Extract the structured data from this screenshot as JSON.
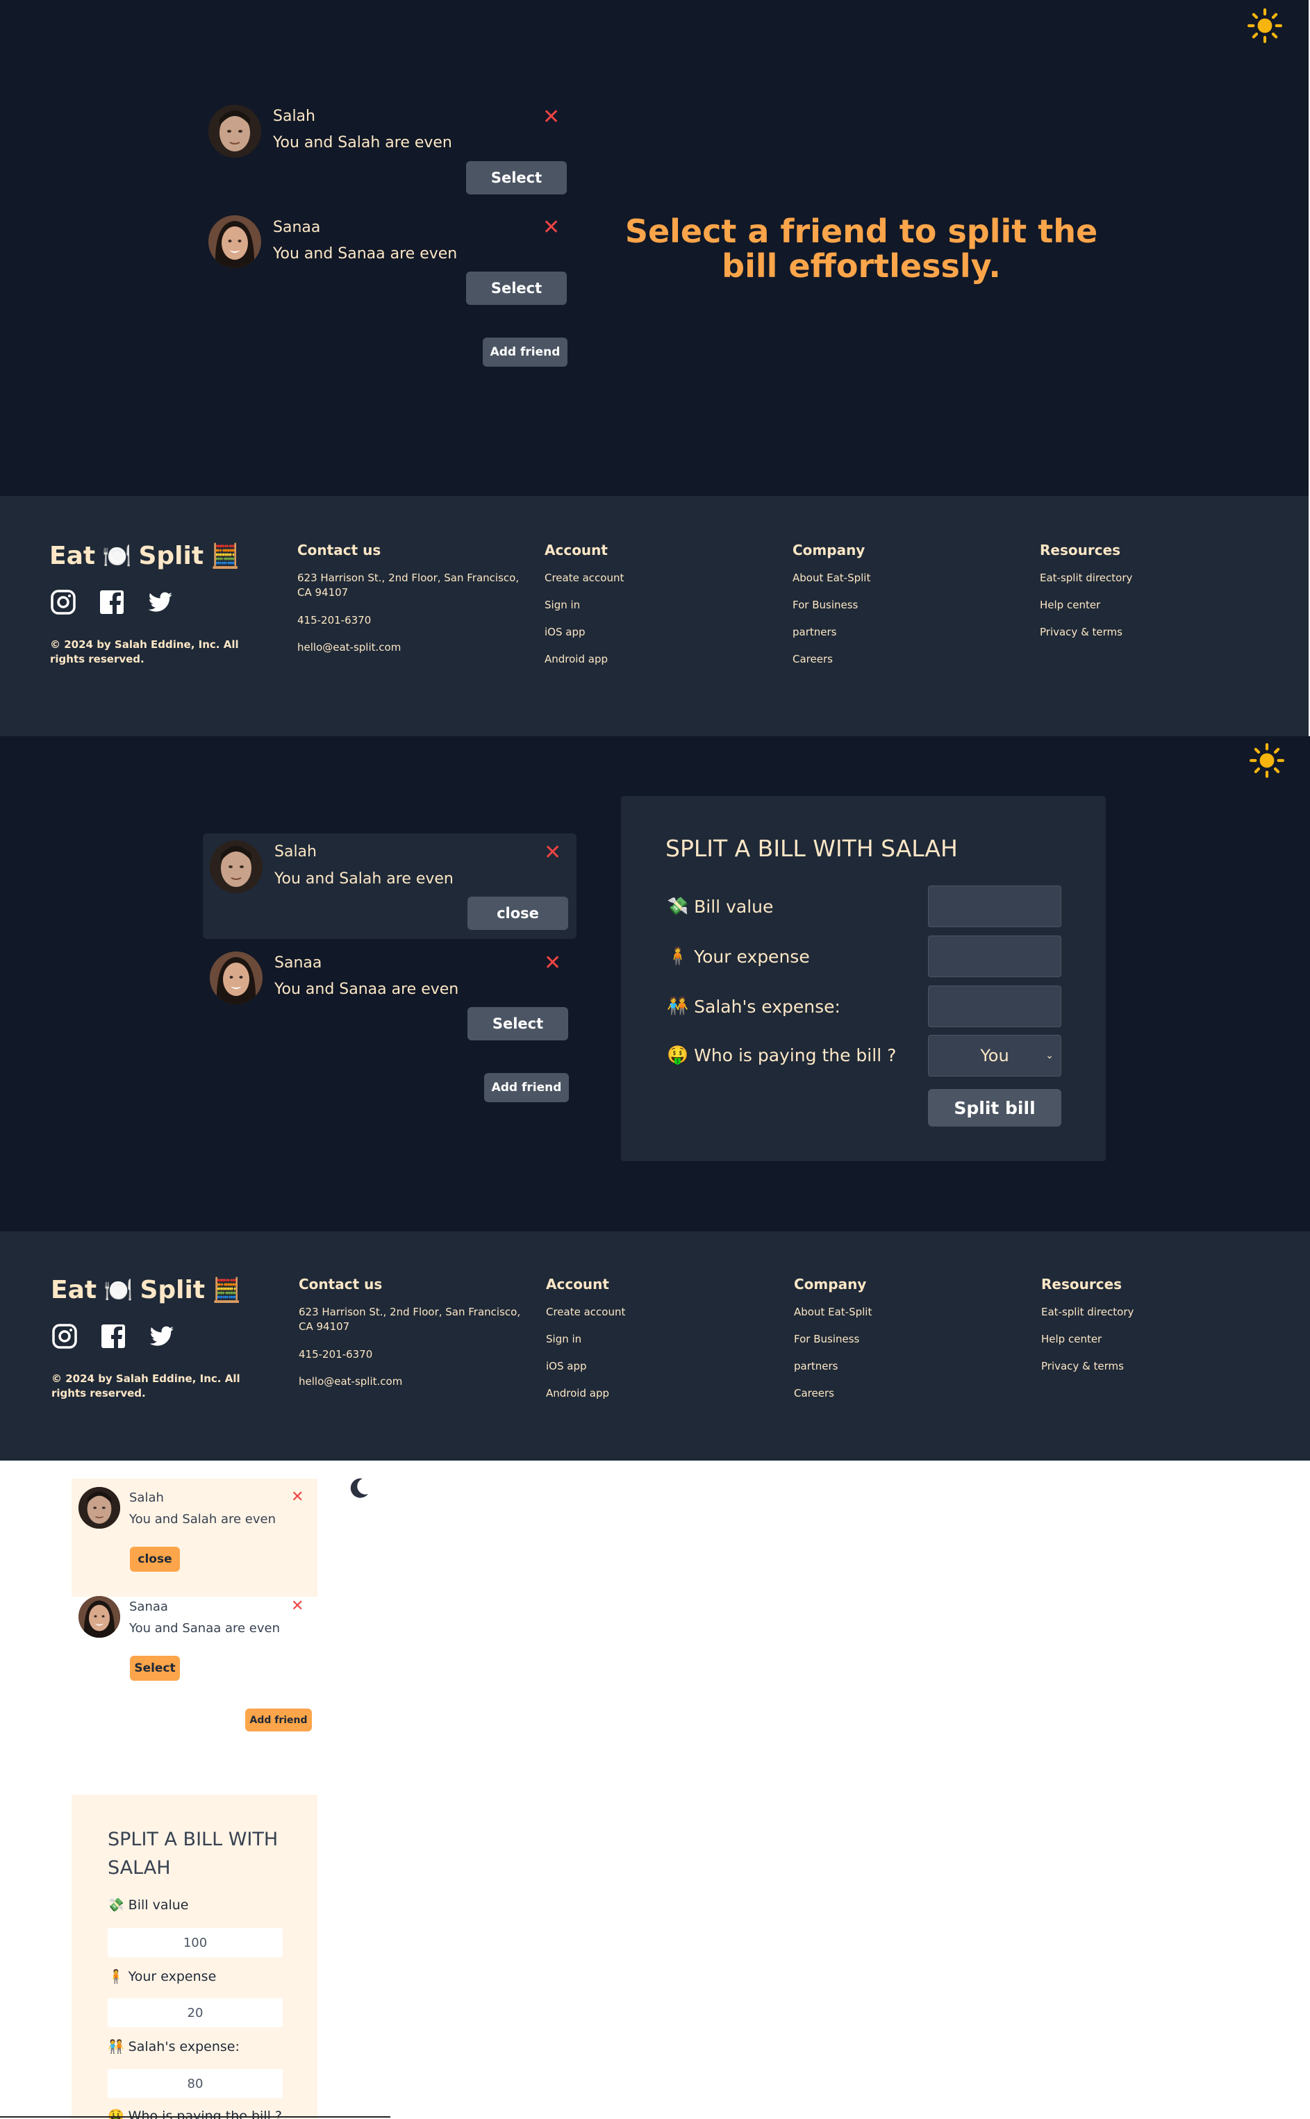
{
  "screen1": {
    "friends": [
      {
        "name": "Salah",
        "status": "You and Salah are even",
        "action": "Select"
      },
      {
        "name": "Sanaa",
        "status": "You and Sanaa are even",
        "action": "Select"
      }
    ],
    "add_friend": "Add friend",
    "headline": "Select a friend to split the bill effortlessly.",
    "theme_icon": "sun-icon"
  },
  "screen2": {
    "friends": [
      {
        "name": "Salah",
        "status": "You and Salah are even",
        "action": "close"
      },
      {
        "name": "Sanaa",
        "status": "You and Sanaa are even",
        "action": "Select"
      }
    ],
    "add_friend": "Add friend",
    "form": {
      "title": "SPLIT A BILL WITH SALAH",
      "bill_label": "Bill value",
      "your_label": "Your expense",
      "friend_label": "Salah's expense:",
      "payer_label": "Who is paying the bill ?",
      "payer_value": "You",
      "submit": "Split bill"
    }
  },
  "screen3": {
    "friends": [
      {
        "name": "Salah",
        "status": "You and Salah are even",
        "action": "close"
      },
      {
        "name": "Sanaa",
        "status": "You and Sanaa are even",
        "action": "Select"
      }
    ],
    "add_friend": "Add friend",
    "form": {
      "title": "SPLIT A BILL WITH SALAH",
      "bill_label": "Bill value",
      "bill_value": "100",
      "your_label": "Your expense",
      "your_value": "20",
      "friend_label": "Salah's expense:",
      "friend_value": "80",
      "payer_label": "Who is paying the bill ?"
    },
    "theme_icon": "moon-icon"
  },
  "footer": {
    "logo_left": "Eat",
    "logo_right": "Split",
    "copyright": "© 2024 by Salah Eddine, Inc. All rights reserved.",
    "contact": {
      "heading": "Contact us",
      "address": "623 Harrison St., 2nd Floor, San Francisco, CA 94107",
      "phone": "415-201-6370",
      "email": "hello@eat-split.com"
    },
    "account": {
      "heading": "Account",
      "items": [
        "Create account",
        "Sign in",
        "iOS app",
        "Android app"
      ]
    },
    "company": {
      "heading": "Company",
      "items": [
        "About Eat-Split",
        "For Business",
        "partners",
        "Careers"
      ]
    },
    "resources": {
      "heading": "Resources",
      "items": [
        "Eat-split directory",
        "Help center",
        "Privacy & terms"
      ]
    }
  },
  "colors": {
    "accent": "#fca54a",
    "dark_bg": "#111827",
    "panel_bg": "#1f2937",
    "close_red": "#ef4444",
    "light_panel": "#fff4e6"
  }
}
